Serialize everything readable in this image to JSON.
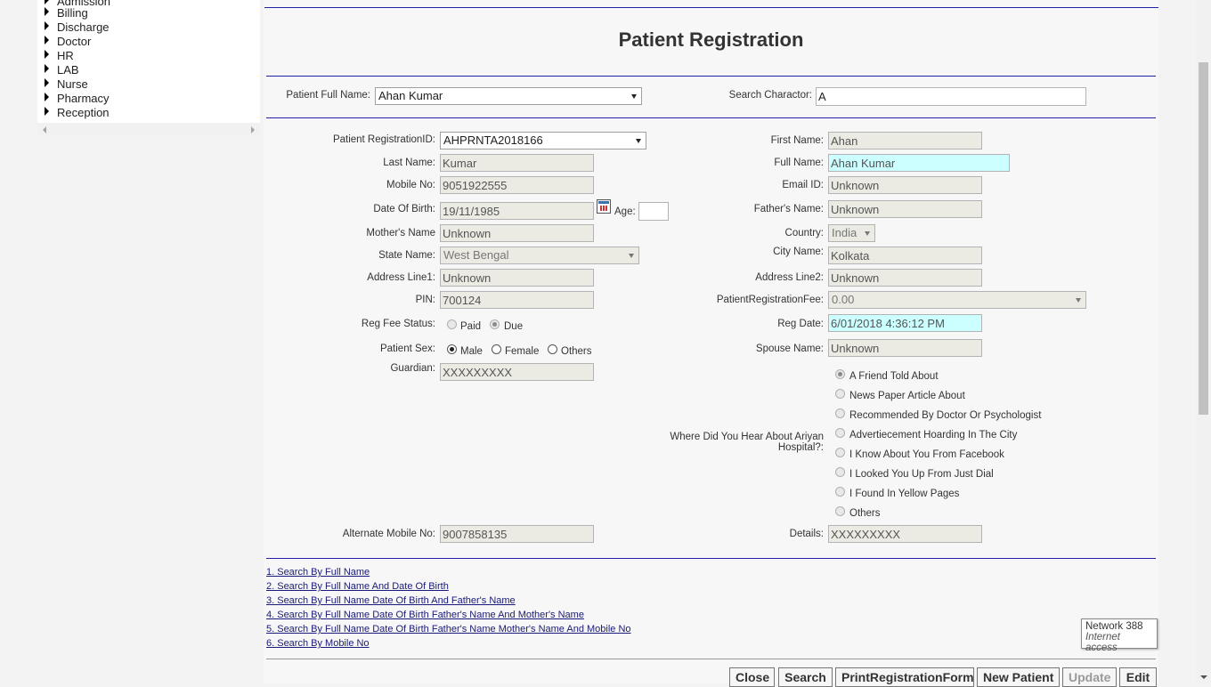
{
  "nav": {
    "items": [
      "Admission",
      "Billing",
      "Discharge",
      "Doctor",
      "HR",
      "LAB",
      "Nurse",
      "Pharmacy",
      "Reception"
    ]
  },
  "page": {
    "title": "Patient Registration"
  },
  "search": {
    "patient_full_name_label": "Patient Full Name:",
    "patient_full_name_value": "Ahan Kumar",
    "search_charactor_label": "Search Charactor:",
    "search_charactor_value": "A"
  },
  "form": {
    "registration_id": {
      "label": "Patient RegistrationID:",
      "value": "AHPRNTA2018166"
    },
    "last_name": {
      "label": "Last Name:",
      "value": "Kumar"
    },
    "mobile_no": {
      "label": "Mobile No:",
      "value": "9051922555"
    },
    "dob": {
      "label": "Date Of Birth:",
      "value": "19/11/1985"
    },
    "age": {
      "label": "Age:",
      "value": ""
    },
    "mothers_name": {
      "label": "Mother's Name",
      "value": "Unknown"
    },
    "state_name": {
      "label": "State Name:",
      "value": "West Bengal"
    },
    "address_line1": {
      "label": "Address Line1:",
      "value": "Unknown"
    },
    "pin": {
      "label": "PIN:",
      "value": "700124"
    },
    "reg_fee_status": {
      "label": "Reg Fee Status:",
      "options": [
        "Paid",
        "Due"
      ],
      "selected": "Due"
    },
    "patient_sex": {
      "label": "Patient Sex:",
      "options": [
        "Male",
        "Female",
        "Others"
      ],
      "selected": "Male"
    },
    "guardian": {
      "label": "Guardian:",
      "value": "XXXXXXXXX"
    },
    "alternate_mobile": {
      "label": "Alternate Mobile No:",
      "value": "9007858135"
    },
    "first_name": {
      "label": "First Name:",
      "value": "Ahan"
    },
    "full_name": {
      "label": "Full Name:",
      "value": "Ahan Kumar"
    },
    "email_id": {
      "label": "Email ID:",
      "value": "Unknown"
    },
    "fathers_name": {
      "label": "Father's Name:",
      "value": "Unknown"
    },
    "country": {
      "label": "Country:",
      "value": "India"
    },
    "city_name": {
      "label": "City Name:",
      "value": "Kolkata"
    },
    "address_line2": {
      "label": "Address Line2:",
      "value": "Unknown"
    },
    "registration_fee": {
      "label": "PatientRegistrationFee:",
      "value": "0.00"
    },
    "reg_date": {
      "label": "Reg Date:",
      "value": "6/01/2018 4:36:12 PM"
    },
    "spouse_name": {
      "label": "Spouse Name:",
      "value": "Unknown"
    },
    "hear_about": {
      "label_line1": "Where Did You Hear About Ariyan",
      "label_line2": "Hospital?:",
      "options": [
        "A Friend Told About",
        "News Paper Article About",
        "Recommended By Doctor Or Psychologist",
        "Advertiecement Hoarding In The City",
        "I Know About You From Facebook",
        "I Looked You Up From Just Dial",
        "I Found In Yellow Pages",
        "Others"
      ],
      "selected": "A Friend Told About"
    },
    "details": {
      "label": "Details:",
      "value": "XXXXXXXXX"
    }
  },
  "search_links": [
    "1. Search By Full Name",
    "2. Search By Full Name And Date Of Birth",
    "3. Search By Full Name Date Of Birth And Father's Name",
    "4. Search By Full Name Date Of Birth Father's Name And Mother's Name",
    "5. Search By Full Name Date Of Birth Father's Name Mother's Name And Mobile No",
    "6. Search By Mobile No"
  ],
  "buttons": {
    "close": "Close",
    "search": "Search",
    "print": "PrintRegistrationForm",
    "new_patient": "New Patient",
    "update": "Update",
    "edit": "Edit"
  },
  "tooltip": {
    "line1": "Network  388",
    "line2": "Internet access"
  }
}
